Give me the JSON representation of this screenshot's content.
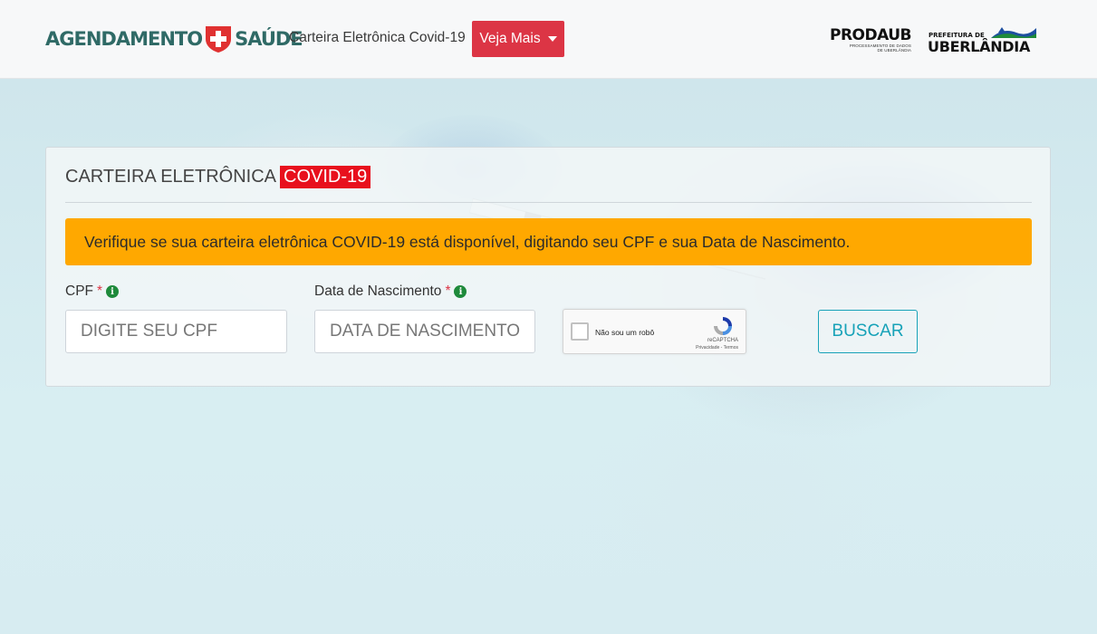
{
  "header": {
    "brand_left": "AGENDAMENTO",
    "brand_right": "SAÚDE",
    "nav_link": "Carteira Eletrônica Covid-19",
    "dropdown_label": "Veja Mais",
    "prodaub_title": "PRODAUB",
    "prodaub_subtitle_1": "PROCESSAMENTO DE DADOS",
    "prodaub_subtitle_2": "DE UBERLÂNDIA",
    "prefeitura_small": "PREFEITURA DE",
    "prefeitura_city": "UBERLÂNDIA"
  },
  "card": {
    "title": "CARTEIRA ELETRÔNICA",
    "title_highlight": "COVID-19",
    "alert": "Verifique se sua carteira eletrônica COVID-19 está disponível, digitando seu CPF e sua Data de Nascimento.",
    "cpf_label": "CPF",
    "cpf_placeholder": "DIGITE SEU CPF",
    "birth_label": "Data de Nascimento",
    "birth_placeholder": "DATA DE NASCIMENTO",
    "required_mark": "*",
    "info_glyph": "i",
    "captcha_text": "Não sou um robô",
    "captcha_brand": "reCAPTCHA",
    "captcha_terms": "Privacidade - Termos",
    "search_button": "BUSCAR"
  },
  "colors": {
    "brand": "#2f6a66",
    "danger": "#dc3545",
    "alert": "#ffa800",
    "highlight": "#e8101d",
    "info": "#17a2b8",
    "background": "#d6ecf0"
  },
  "icons": [
    "medical-cross-shield-icon",
    "caret-down-icon",
    "info-icon",
    "recaptcha-icon"
  ]
}
